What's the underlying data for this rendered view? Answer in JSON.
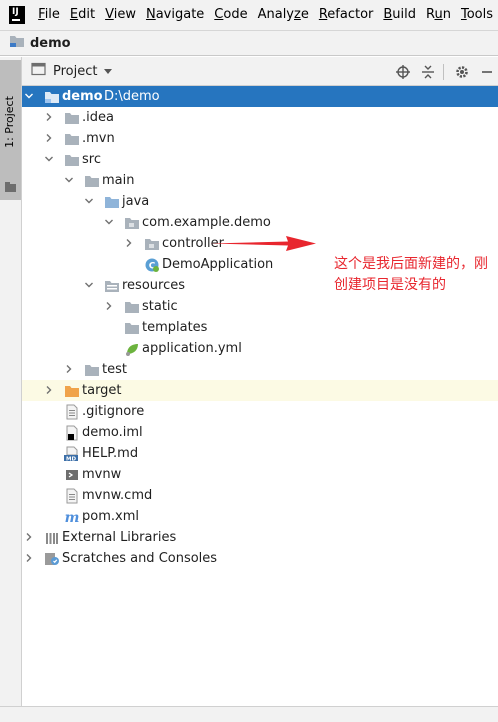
{
  "menu": {
    "logo": "IJ",
    "items": [
      {
        "pre": "",
        "mn": "F",
        "post": "ile"
      },
      {
        "pre": "",
        "mn": "E",
        "post": "dit"
      },
      {
        "pre": "",
        "mn": "V",
        "post": "iew"
      },
      {
        "pre": "",
        "mn": "N",
        "post": "avigate"
      },
      {
        "pre": "",
        "mn": "C",
        "post": "ode"
      },
      {
        "pre": "Analy",
        "mn": "z",
        "post": "e"
      },
      {
        "pre": "",
        "mn": "R",
        "post": "efactor"
      },
      {
        "pre": "",
        "mn": "B",
        "post": "uild"
      },
      {
        "pre": "R",
        "mn": "u",
        "post": "n"
      },
      {
        "pre": "",
        "mn": "T",
        "post": "ools"
      }
    ]
  },
  "breadcrumb": {
    "project": "demo"
  },
  "stripe": {
    "tab_label": "1: Project"
  },
  "panel": {
    "title": "Project"
  },
  "tree": [
    {
      "label": "demo",
      "extra": "D:\\demo",
      "depth": 0,
      "arrow": "down",
      "icon": "module-folder-icon",
      "state": "selected"
    },
    {
      "label": ".idea",
      "depth": 1,
      "arrow": "right",
      "icon": "folder-icon"
    },
    {
      "label": ".mvn",
      "depth": 1,
      "arrow": "right",
      "icon": "folder-icon"
    },
    {
      "label": "src",
      "depth": 1,
      "arrow": "down",
      "icon": "folder-icon"
    },
    {
      "label": "main",
      "depth": 2,
      "arrow": "down",
      "icon": "folder-icon"
    },
    {
      "label": "java",
      "depth": 3,
      "arrow": "down",
      "icon": "source-folder-icon"
    },
    {
      "label": "com.example.demo",
      "depth": 4,
      "arrow": "down",
      "icon": "package-icon"
    },
    {
      "label": "controller",
      "depth": 5,
      "arrow": "right",
      "icon": "package-icon"
    },
    {
      "label": "DemoApplication",
      "depth": 5,
      "arrow": "",
      "icon": "spring-class-icon"
    },
    {
      "label": "resources",
      "depth": 3,
      "arrow": "down",
      "icon": "resources-folder-icon"
    },
    {
      "label": "static",
      "depth": 4,
      "arrow": "right",
      "icon": "folder-icon"
    },
    {
      "label": "templates",
      "depth": 4,
      "arrow": "",
      "icon": "folder-icon"
    },
    {
      "label": "application.yml",
      "depth": 4,
      "arrow": "",
      "icon": "yml-file-icon"
    },
    {
      "label": "test",
      "depth": 2,
      "arrow": "right",
      "icon": "folder-icon"
    },
    {
      "label": "target",
      "depth": 1,
      "arrow": "right",
      "icon": "excluded-folder-icon",
      "state": "excluded"
    },
    {
      "label": ".gitignore",
      "depth": 1,
      "arrow": "",
      "icon": "text-file-icon"
    },
    {
      "label": "demo.iml",
      "depth": 1,
      "arrow": "",
      "icon": "iml-file-icon"
    },
    {
      "label": "HELP.md",
      "depth": 1,
      "arrow": "",
      "icon": "markdown-file-icon"
    },
    {
      "label": "mvnw",
      "depth": 1,
      "arrow": "",
      "icon": "script-file-icon"
    },
    {
      "label": "mvnw.cmd",
      "depth": 1,
      "arrow": "",
      "icon": "text-file-icon"
    },
    {
      "label": "pom.xml",
      "depth": 1,
      "arrow": "",
      "icon": "maven-file-icon"
    },
    {
      "label": "External Libraries",
      "depth": 0,
      "arrow": "right",
      "icon": "libraries-icon"
    },
    {
      "label": "Scratches and Consoles",
      "depth": 0,
      "arrow": "right",
      "icon": "scratches-icon"
    }
  ],
  "annotation": {
    "text": "这个是我后面新建的，刚创建项目是没有的",
    "color": "#e8262e"
  },
  "colors": {
    "selection": "#2675bf",
    "folder": "#a9b2bb",
    "source_folder": "#8fb4d9",
    "excluded_folder": "#f0a34a"
  }
}
